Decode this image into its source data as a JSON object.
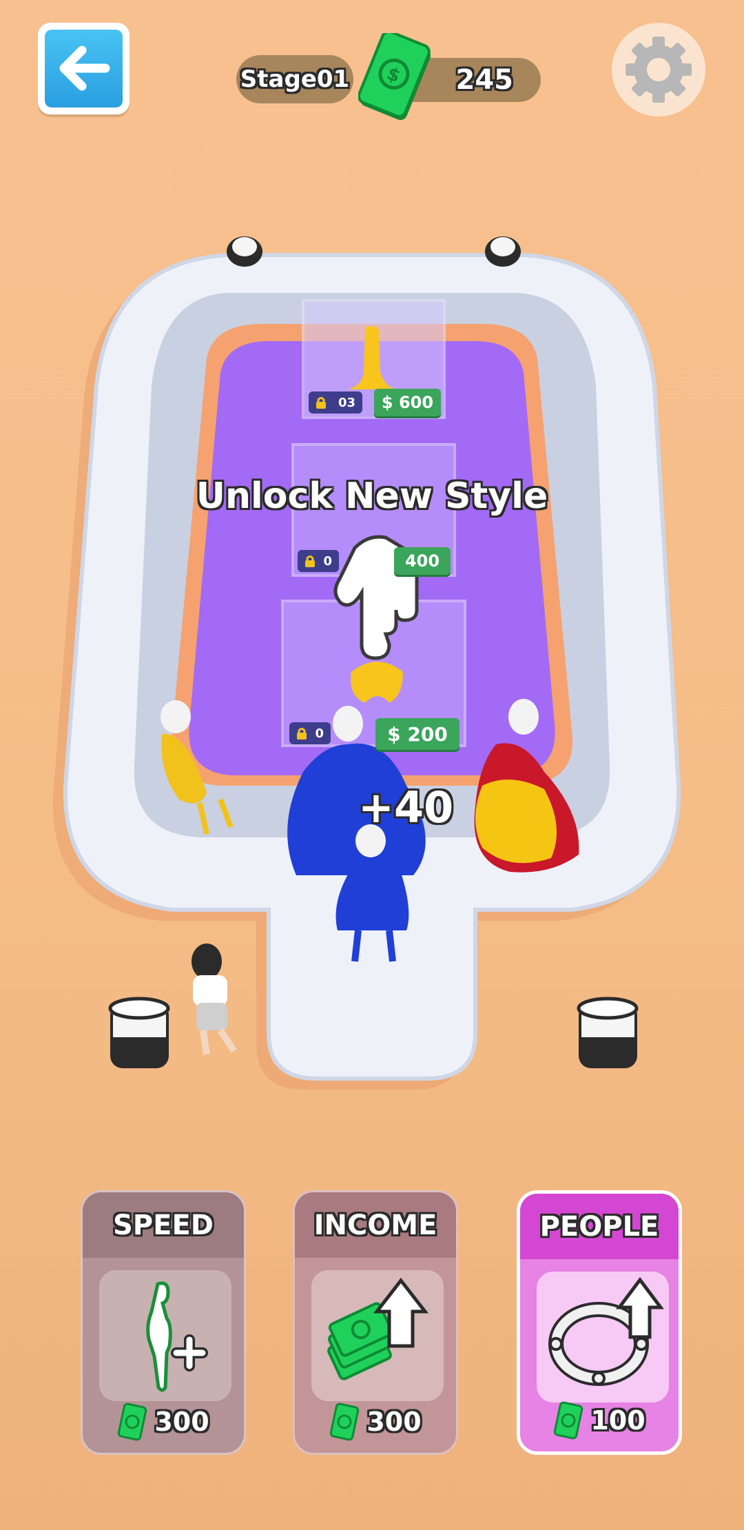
{
  "hud": {
    "stage_label": "Stage01",
    "money": "245",
    "back_icon": "arrow-left-icon",
    "settings_icon": "gear-icon"
  },
  "scene": {
    "hint_text": "Unlock New Style",
    "reward_text": "+40",
    "dress_slots": [
      {
        "lock_level": "03",
        "price": "$ 600"
      },
      {
        "lock_level": "0",
        "price": "400"
      },
      {
        "lock_level": "0",
        "price": "$ 200"
      }
    ]
  },
  "upgrades": [
    {
      "title": "SPEED",
      "cost": "300",
      "icon": "runner-plus-icon"
    },
    {
      "title": "INCOME",
      "cost": "300",
      "icon": "cash-up-arrow-icon"
    },
    {
      "title": "PEOPLE",
      "cost": "100",
      "icon": "ring-up-arrow-icon"
    }
  ],
  "colors": {
    "background": "#f5bd88",
    "runway_floor": "#a36af5",
    "people_card": "#d447d2",
    "money_green": "#1fb24a"
  }
}
